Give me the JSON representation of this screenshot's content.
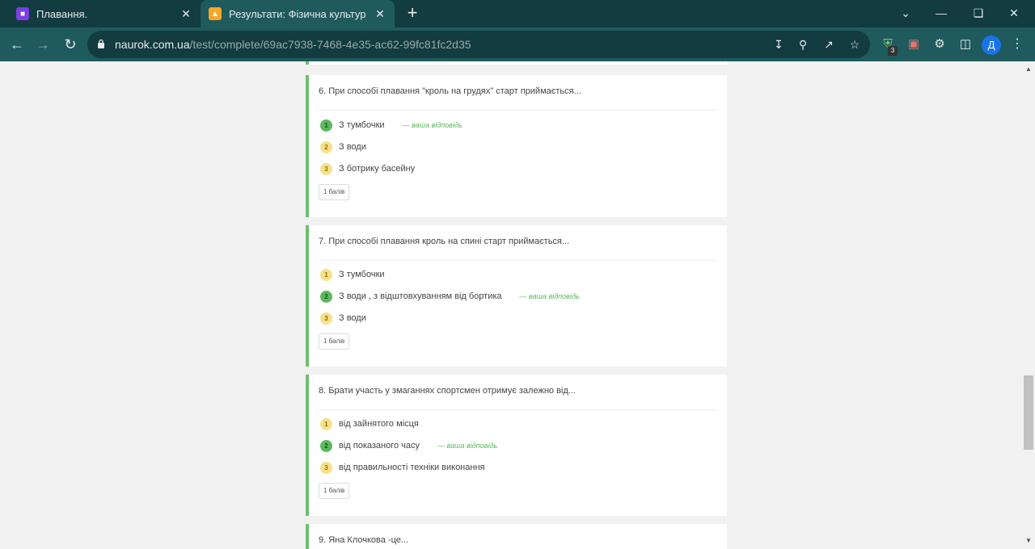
{
  "browser": {
    "tabs": [
      {
        "title": "Плавання.",
        "favicon": "classroom-icon",
        "active": false
      },
      {
        "title": "Результати: Фізична культура.М",
        "favicon": "naurok-icon",
        "active": true
      }
    ],
    "url_domain": "naurok.com.ua",
    "url_path": "/test/complete/69ac7938-7468-4e35-ac62-99fc81fc2d35",
    "extension_badge": "3",
    "profile_initial": "Д",
    "theme_color": "#1f5a5d"
  },
  "questions": [
    {
      "text": "6. При способі плавання \"кроль на грудях\" старт приймається...",
      "answers": [
        {
          "num": "1",
          "text": "З тумбочки",
          "correct": true,
          "your_answer": "— ваша відповідь"
        },
        {
          "num": "2",
          "text": "З води",
          "correct": false
        },
        {
          "num": "3",
          "text": "З ботрику басейну",
          "correct": false
        }
      ],
      "points": "1 балів"
    },
    {
      "text": "7. При способі плавання кроль на спині старт приймається...",
      "answers": [
        {
          "num": "1",
          "text": "З тумбочки",
          "correct": false
        },
        {
          "num": "2",
          "text": "З води , з відштовхуванням від бортика",
          "correct": true,
          "your_answer": "— ваша відповідь"
        },
        {
          "num": "3",
          "text": "З води",
          "correct": false
        }
      ],
      "points": "1 балів"
    },
    {
      "text": "8. Брати участь у змаганнях спортсмен отримує залежно від...",
      "answers": [
        {
          "num": "1",
          "text": "від зайнятого місця",
          "correct": false
        },
        {
          "num": "2",
          "text": "від показаного часу",
          "correct": true,
          "your_answer": "— ваша відповідь"
        },
        {
          "num": "3",
          "text": "від правильності техніки виконання",
          "correct": false
        }
      ],
      "points": "1 балів"
    },
    {
      "text": "9. Яна Клочкова -це..."
    }
  ],
  "colors": {
    "correct": "#5cb85c",
    "wrong": "#f7e08a",
    "card_accent": "#6cc070"
  }
}
